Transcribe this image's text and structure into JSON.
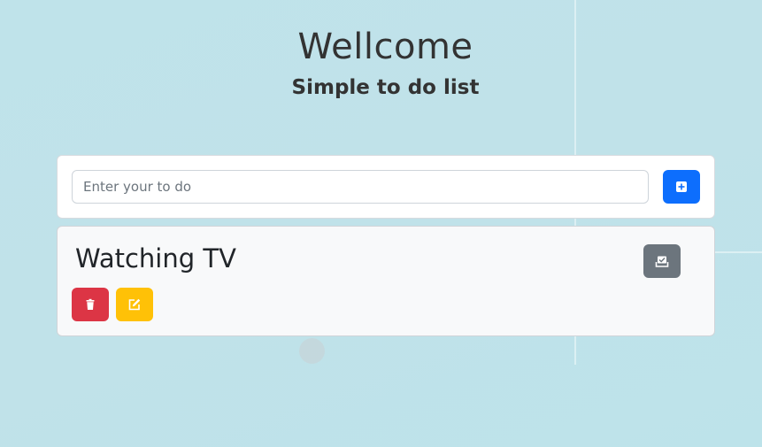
{
  "header": {
    "title": "Wellcome",
    "subtitle": "Simple to do list"
  },
  "input": {
    "placeholder": "Enter your to do",
    "value": ""
  },
  "buttons": {
    "add_icon": "plus-square-icon",
    "done_icon": "check-tray-icon",
    "delete_icon": "trash-icon",
    "edit_icon": "edit-pencil-icon"
  },
  "todos": [
    {
      "text": "Watching TV"
    }
  ],
  "colors": {
    "primary": "#0d6efd",
    "secondary": "#6c757d",
    "danger": "#dc3545",
    "warning": "#ffc107",
    "background": "#bfe3ea"
  }
}
